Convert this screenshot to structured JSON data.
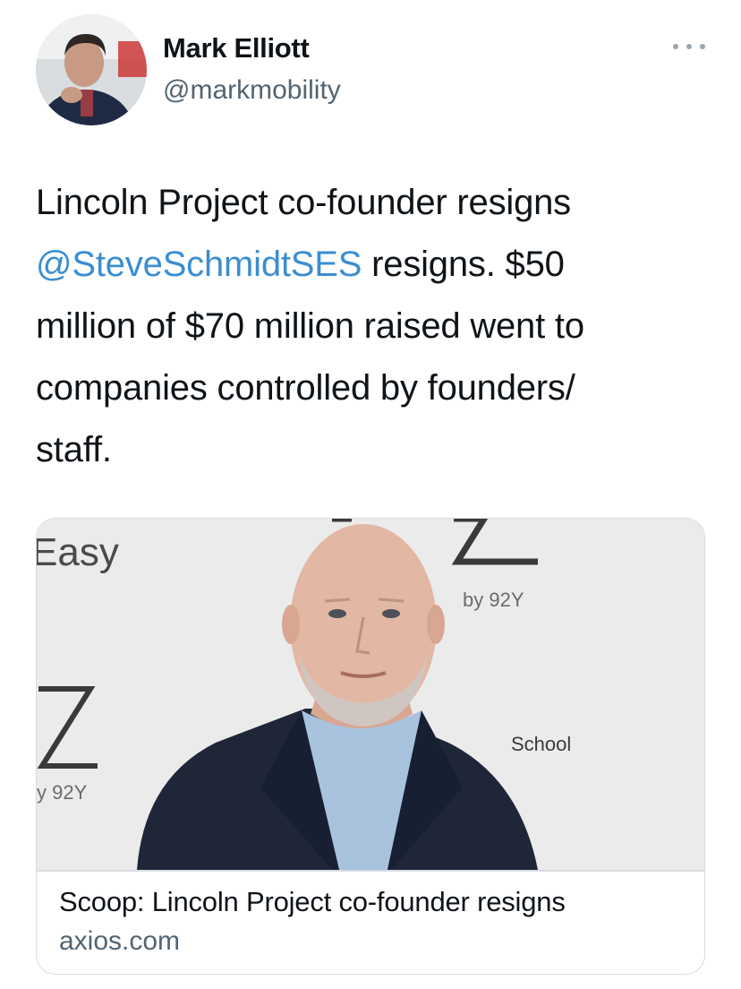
{
  "author": {
    "name": "Mark Elliott",
    "handle": "@markmobility"
  },
  "tweet": {
    "line1": "Lincoln Project co-founder resigns",
    "mention": "@SteveSchmidtSES",
    "after_mention": " resigns. $50",
    "line3": "million of $70 million raised went to",
    "line4": "companies controlled by founders/",
    "line5": "staff."
  },
  "card": {
    "backdrop_text": {
      "easy": "Easy",
      "by92y_right": "by 92Y",
      "by92y_left": "y 92Y",
      "school": "School"
    },
    "title": "Scoop: Lincoln Project co-founder resigns",
    "domain": "axios.com"
  },
  "colors": {
    "mention": "#3b8ed1",
    "secondary_text": "#536471",
    "border": "#d6dce1"
  },
  "icons": {
    "more": "more-horizontal-icon"
  }
}
